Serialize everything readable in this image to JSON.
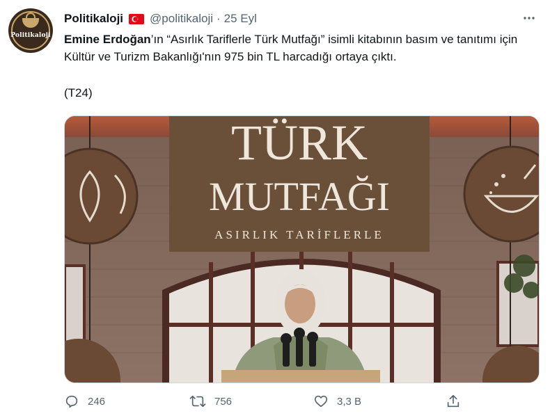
{
  "tweet": {
    "author": {
      "display_name": "Politikaloji",
      "handle": "@politikaloji",
      "avatar_text": "Politikaloji"
    },
    "separator": "·",
    "date": "25 Eyl",
    "more_label": "···",
    "text_bold": "Emine Erdoğan",
    "text_rest": "’ın “Asırlık Tariflerle Türk Mutfağı” isimli kitabının basım ve tanıtımı için Kültür ve Turizm Bakanlığı'nın 975 bin TL harcadığı ortaya çıktı.",
    "source": "(T24)",
    "image": {
      "banner_line1": "TÜRK",
      "banner_line2": "MUTFAĞI",
      "banner_line3": "ASIRLIK TARİFLERLE"
    },
    "actions": {
      "replies": "246",
      "retweets": "756",
      "likes": "3,3 B"
    }
  },
  "colors": {
    "text": "#0f1419",
    "secondary": "#536471",
    "flag_red": "#e30a17",
    "banner": "#6a5038"
  }
}
